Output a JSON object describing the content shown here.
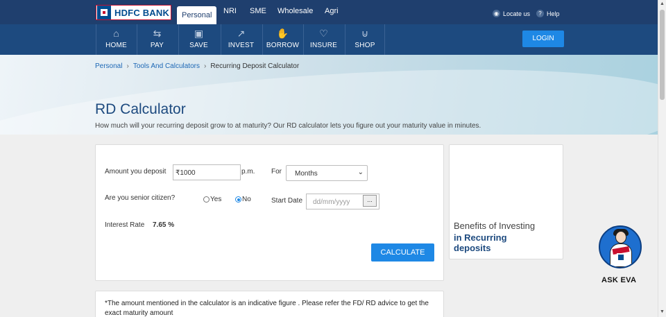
{
  "topbar": {
    "logo_text": "HDFC BANK",
    "tabs": [
      {
        "label": "Personal",
        "active": true
      },
      {
        "label": "NRI",
        "active": false
      },
      {
        "label": "SME",
        "active": false
      },
      {
        "label": "Wholesale",
        "active": false
      },
      {
        "label": "Agri",
        "active": false
      }
    ],
    "locate": "Locate us",
    "help": "Help"
  },
  "nav": {
    "items": [
      {
        "label": "HOME",
        "icon": "home-icon"
      },
      {
        "label": "PAY",
        "icon": "pay-icon"
      },
      {
        "label": "SAVE",
        "icon": "save-icon"
      },
      {
        "label": "INVEST",
        "icon": "invest-icon"
      },
      {
        "label": "BORROW",
        "icon": "borrow-icon"
      },
      {
        "label": "INSURE",
        "icon": "insure-icon"
      },
      {
        "label": "SHOP",
        "icon": "shop-icon"
      }
    ],
    "login": "LOGIN"
  },
  "breadcrumb": {
    "items": [
      "Personal",
      "Tools And Calculators",
      "Recurring Deposit Calculator"
    ]
  },
  "hero": {
    "title": "RD Calculator",
    "subtitle": "How much will your recurring deposit grow to at maturity? Our RD calculator lets you figure out your maturity value in minutes."
  },
  "calculator": {
    "amount_label": "Amount you deposit",
    "amount_value": "₹1000",
    "amount_suffix": "p.m.",
    "for_label": "For",
    "for_value": "Months",
    "senior_label": "Are you senior citizen?",
    "yes_label": "Yes",
    "no_label": "No",
    "senior_selected": "No",
    "start_date_label": "Start Date",
    "start_date_placeholder": "dd/mm/yyyy",
    "date_button": "...",
    "interest_label": "Interest Rate",
    "interest_value": "7.65 %",
    "calculate": "CALCULATE"
  },
  "side_card": {
    "line1": "Benefits of Investing",
    "line2": "in Recurring deposits"
  },
  "note": "*The amount mentioned in the calculator is an indicative figure . Please refer the FD/ RD advice to get the exact maturity amount",
  "eva": {
    "label": "ASK EVA"
  },
  "colors": {
    "brand_navy": "#1f3f6e",
    "nav_blue": "#1d4a7f",
    "accent": "#1e88e5",
    "brand_red": "#c8102e"
  }
}
